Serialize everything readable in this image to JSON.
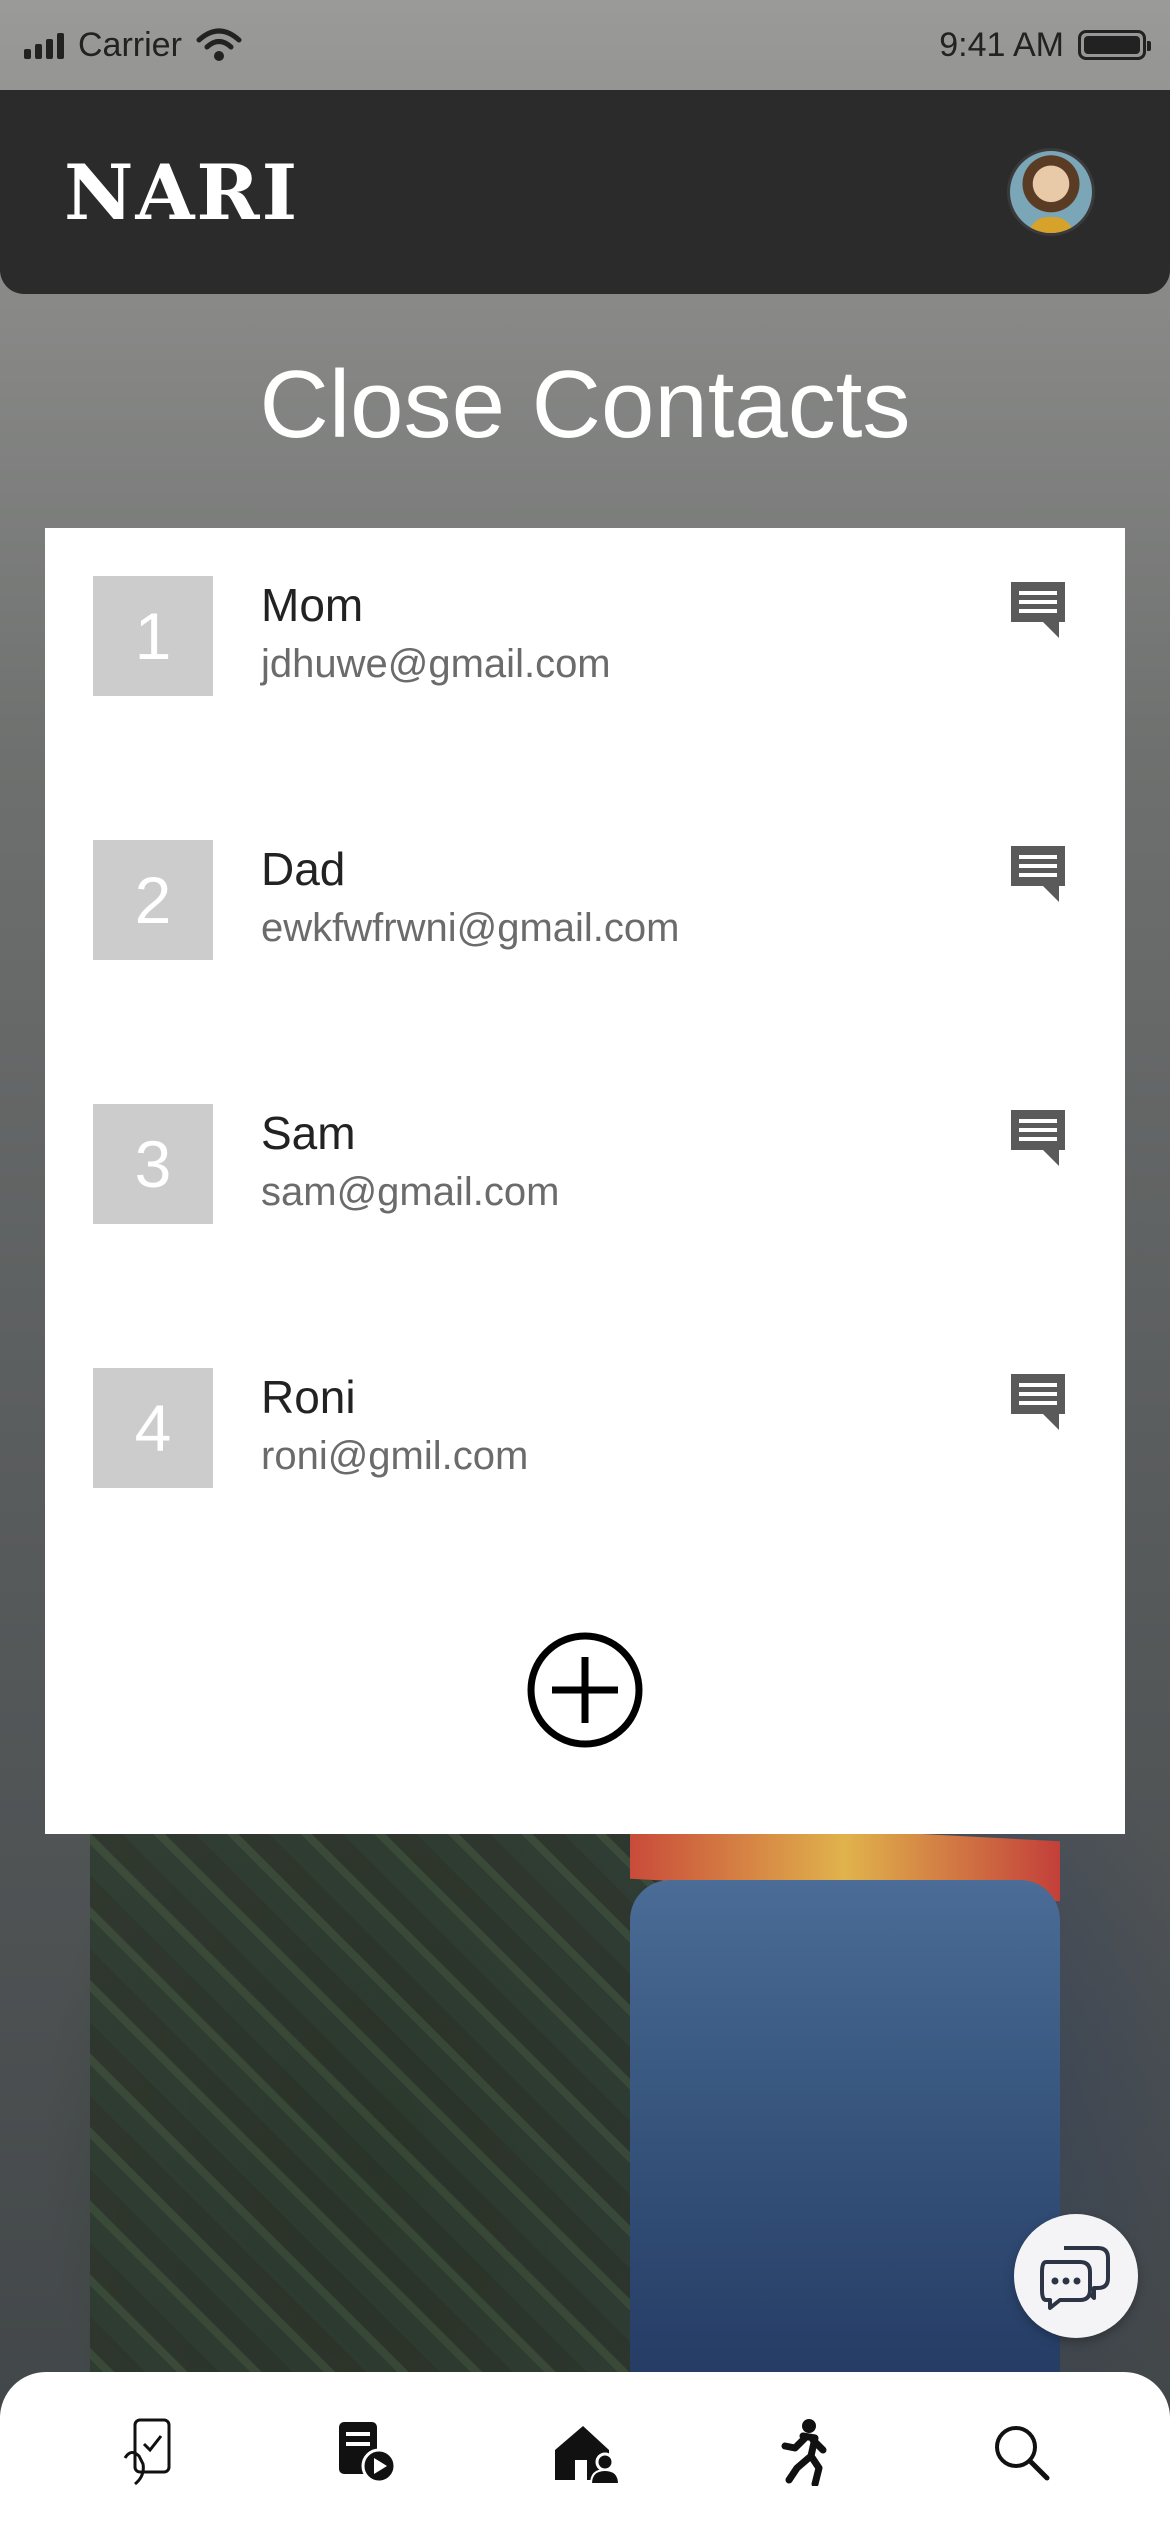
{
  "status_bar": {
    "carrier": "Carrier",
    "time": "9:41 AM"
  },
  "header": {
    "logo": "NARI",
    "avatar_icon": "user-avatar"
  },
  "page": {
    "title": "Close Contacts"
  },
  "contacts": [
    {
      "number": "1",
      "name": "Mom",
      "email": "jdhuwe@gmail.com",
      "action_icon": "message-icon"
    },
    {
      "number": "2",
      "name": "Dad",
      "email": "ewkfwfrwni@gmail.com",
      "action_icon": "message-icon"
    },
    {
      "number": "3",
      "name": "Sam",
      "email": "sam@gmail.com",
      "action_icon": "message-icon"
    },
    {
      "number": "4",
      "name": "Roni",
      "email": "roni@gmil.com",
      "action_icon": "message-icon"
    }
  ],
  "add_contact_icon": "plus-circle-icon",
  "chat_fab_icon": "chat-bubbles-icon",
  "bottom_nav": [
    {
      "id": "phone-safety",
      "icon": "phone-check-icon"
    },
    {
      "id": "videos",
      "icon": "document-play-icon"
    },
    {
      "id": "home",
      "icon": "home-person-icon"
    },
    {
      "id": "walk",
      "icon": "walking-person-icon"
    },
    {
      "id": "search",
      "icon": "search-icon"
    }
  ],
  "colors": {
    "header_bg": "#2b2b2b",
    "card_bg": "#ffffff",
    "number_box": "#cccccc",
    "message_icon": "#5a5a5a",
    "text_primary": "#222222",
    "text_secondary": "#6b6b6b"
  }
}
